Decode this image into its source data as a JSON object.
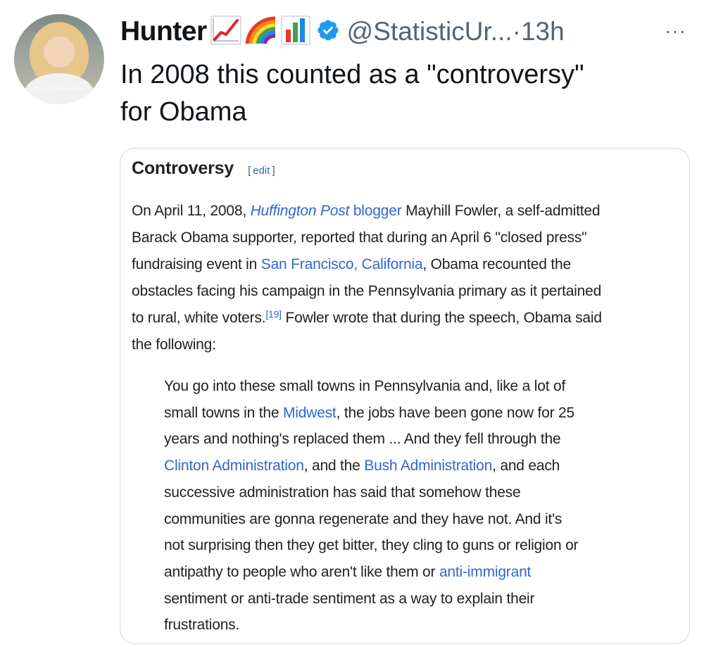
{
  "author": {
    "display_name": "Hunter",
    "emojis": [
      "chart-increasing-emoji",
      "rainbow-emoji",
      "bar-chart-emoji"
    ],
    "handle": "@StatisticUr...",
    "separator": "·",
    "timestamp": "13h",
    "avatar_caption": "This Is The Bad Place"
  },
  "tweet": {
    "text_line1": "In 2008 this counted as a \"controversy\"",
    "text_line2": "for Obama",
    "more_label": "···"
  },
  "wiki": {
    "heading": "Controversy",
    "edit_open": "[",
    "edit_label": "edit",
    "edit_close": "]",
    "para_lines": [
      {
        "parts": [
          {
            "t": "On April 11, 2008, "
          },
          {
            "t": "Huffington Post",
            "link": true,
            "italic": true
          },
          {
            "t": " ",
            "link": true
          },
          {
            "t": "blogger",
            "link": true
          },
          {
            "t": " Mayhill Fowler, a self-admitted"
          }
        ]
      },
      {
        "parts": [
          {
            "t": "Barack Obama supporter, reported that during an April 6 \"closed press\""
          }
        ]
      },
      {
        "parts": [
          {
            "t": "fundraising event in "
          },
          {
            "t": "San Francisco, California",
            "link": true
          },
          {
            "t": ", Obama recounted the"
          }
        ]
      },
      {
        "parts": [
          {
            "t": "obstacles facing his campaign in the Pennsylvania primary as it pertained"
          }
        ]
      },
      {
        "parts": [
          {
            "t": "to rural, white voters."
          },
          {
            "t": "[19]",
            "link": true,
            "sup": true
          },
          {
            "t": " Fowler wrote that during the speech, Obama said"
          }
        ]
      },
      {
        "parts": [
          {
            "t": "the following:"
          }
        ]
      }
    ],
    "quote_lines": [
      {
        "parts": [
          {
            "t": "You go into these small towns in Pennsylvania and, like a lot of"
          }
        ]
      },
      {
        "parts": [
          {
            "t": "small towns in the "
          },
          {
            "t": "Midwest",
            "link": true
          },
          {
            "t": ", the jobs have been gone now for 25"
          }
        ]
      },
      {
        "parts": [
          {
            "t": "years and nothing's replaced them ... And they fell through the"
          }
        ]
      },
      {
        "parts": [
          {
            "t": "Clinton Administration",
            "link": true
          },
          {
            "t": ", and the "
          },
          {
            "t": "Bush Administration",
            "link": true
          },
          {
            "t": ", and each"
          }
        ]
      },
      {
        "parts": [
          {
            "t": "successive administration has said that somehow these"
          }
        ]
      },
      {
        "parts": [
          {
            "t": "communities are gonna regenerate and they have not. And it's"
          }
        ]
      },
      {
        "parts": [
          {
            "t": "not surprising then they get bitter, they cling to guns or religion or"
          }
        ]
      },
      {
        "parts": [
          {
            "t": "antipathy to people who aren't like them or "
          },
          {
            "t": "anti-immigrant",
            "link": true
          }
        ]
      },
      {
        "parts": [
          {
            "t": "sentiment or anti-trade sentiment as a way to explain their"
          }
        ]
      },
      {
        "parts": [
          {
            "t": "frustrations."
          }
        ]
      }
    ]
  },
  "colors": {
    "text": "#0f1419",
    "secondary": "#536471",
    "verified": "#1d9bf0",
    "wiki_link": "#3366cc",
    "card_border": "#cfd9de"
  }
}
